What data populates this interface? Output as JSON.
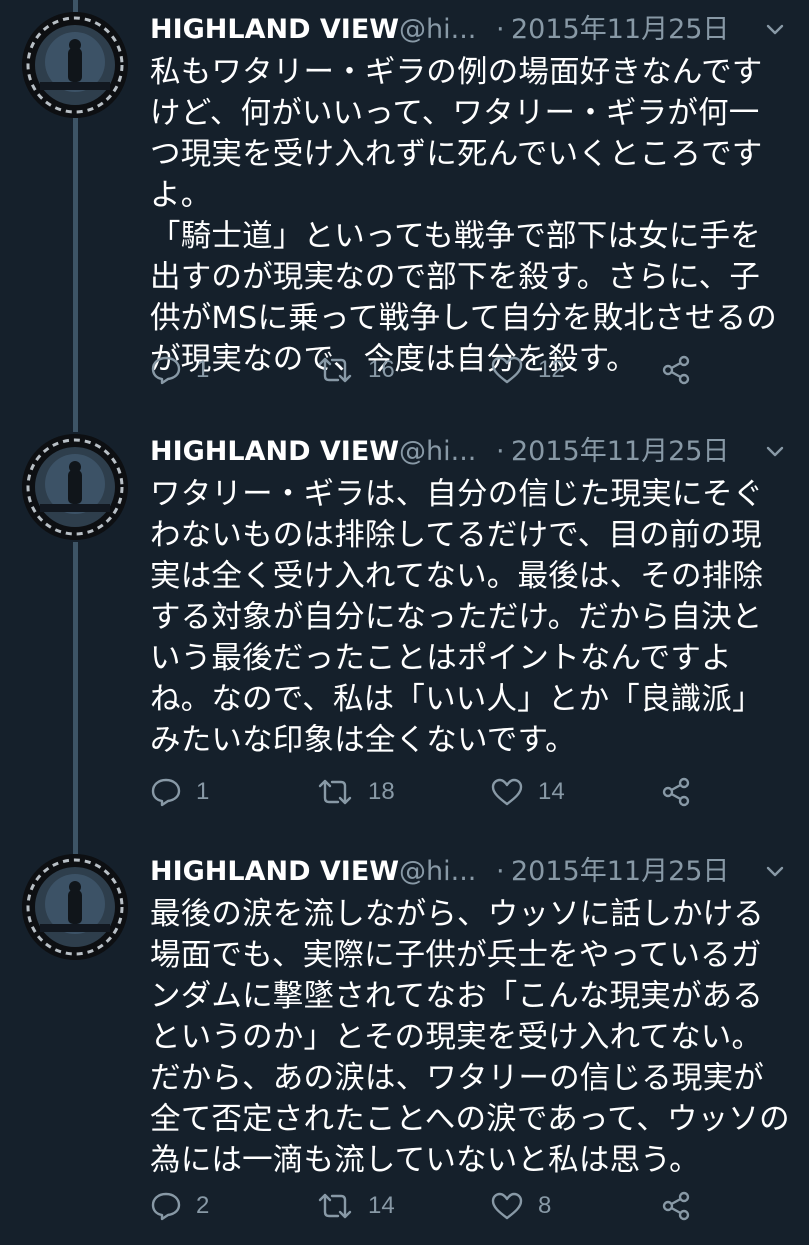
{
  "colors": {
    "background": "#15202b",
    "text": "#ffffff",
    "secondary": "#8899a6",
    "thread_line": "#3d5466"
  },
  "tweets": [
    {
      "name": "HIGHLAND VIEW",
      "handle": "@hi...",
      "separator": "·",
      "date": "2015年11月25日",
      "text": "私もワタリー・ギラの例の場面好きなんですけど、何がいいって、ワタリー・ギラが何一つ現実を受け入れずに死んでいくところですよ。\n「騎士道」といっても戦争で部下は女に手を出すのが現実なので部下を殺す。さらに、子供がMSに乗って戦争して自分を敗北させるのが現実なので、今度は自分を殺す。",
      "replies": "1",
      "retweets": "16",
      "likes": "12"
    },
    {
      "name": "HIGHLAND VIEW",
      "handle": "@hi...",
      "separator": "·",
      "date": "2015年11月25日",
      "text": "ワタリー・ギラは、自分の信じた現実にそぐわないものは排除してるだけで、目の前の現実は全く受け入れてない。最後は、その排除する対象が自分になっただけ。だから自決という最後だったことはポイントなんですよね。なので、私は「いい人」とか「良識派」みたいな印象は全くないです。",
      "replies": "1",
      "retweets": "18",
      "likes": "14"
    },
    {
      "name": "HIGHLAND VIEW",
      "handle": "@hi...",
      "separator": "·",
      "date": "2015年11月25日",
      "text": "最後の涙を流しながら、ウッソに話しかける場面でも、実際に子供が兵士をやっているガンダムに撃墜されてなお「こんな現実があるというのか」とその現実を受け入れてない。だから、あの涙は、ワタリーの信じる現実が全て否定されたことへの涙であって、ウッソの為には一滴も流していないと私は思う。",
      "replies": "2",
      "retweets": "14",
      "likes": "8"
    }
  ]
}
